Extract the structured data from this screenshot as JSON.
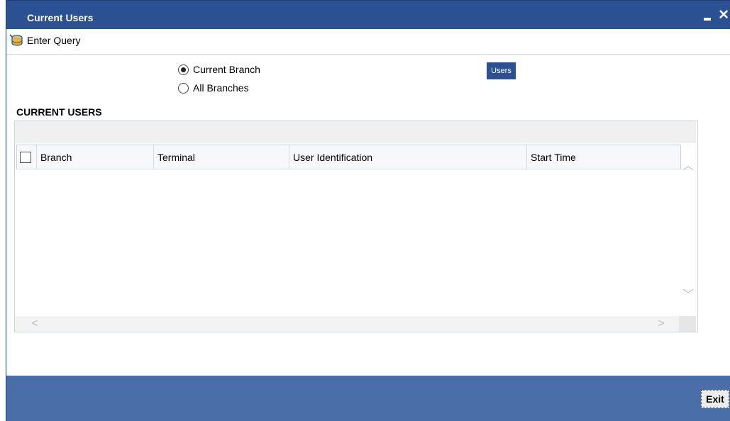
{
  "window": {
    "title": "Current Users"
  },
  "toolbar": {
    "enter_query_label": "Enter Query"
  },
  "options": {
    "current_branch_label": "Current Branch",
    "all_branches_label": "All Branches",
    "selected": "current_branch"
  },
  "users_button_label": "Users",
  "section": {
    "title": "CURRENT USERS"
  },
  "grid": {
    "columns": [
      "Branch",
      "Terminal",
      "User Identification",
      "Start Time"
    ],
    "rows": []
  },
  "footer": {
    "exit_label": "Exit"
  },
  "colors": {
    "titlebar": "#2c5192",
    "footer": "#4a6ea8",
    "button": "#2c5192"
  }
}
